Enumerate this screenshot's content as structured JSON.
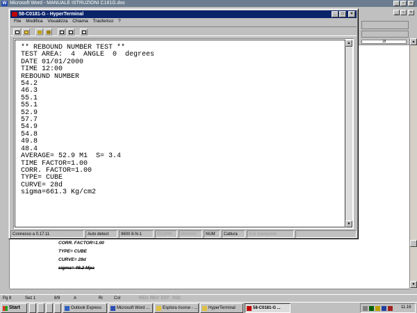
{
  "word": {
    "title": "Microsoft Word - MANUALE ISTRUZIONI C181G.doc",
    "app_icon": "W",
    "ruler_label": "18",
    "doc_lines": [
      "CORR. FACTOR=1.00",
      "TYPE= CUBE",
      "CURVE= 28d",
      "sigma= 49.2 Mpa"
    ],
    "status": {
      "page": "Pg 8",
      "section": "Sez 1",
      "pages": "8/9",
      "at": "A",
      "line": "Ri",
      "col": "Col",
      "rec": "REG",
      "rev": "REV",
      "ext": "EST",
      "ovr": "SSC"
    }
  },
  "hyperterminal": {
    "title": "58-C0181-G - HyperTerminal",
    "menu": [
      "File",
      "Modifica",
      "Visualizza",
      "Chiama",
      "Trasferisci",
      "?"
    ],
    "toolbar_icons": [
      "new-icon",
      "open-icon",
      "phone-icon",
      "disconnect-icon",
      "send-icon",
      "receive-icon",
      "properties-icon"
    ],
    "terminal_lines": [
      "** REBOUND NUMBER TEST **",
      "TEST AREA:  4  ANGLE  0  degrees",
      "DATE 01/01/2000",
      "TIME 12:00",
      "REBOUND NUMBER",
      "54.2",
      "46.3",
      "55.1",
      "55.1",
      "52.9",
      "57.7",
      "54.9",
      "54.8",
      "49.8",
      "48.4",
      "AVERAGE= 52.9 M1  S= 3.4",
      "TIME FACTOR=1.00",
      "CORR. FACTOR=1.00",
      "TYPE= CUBE",
      "CURVE= 28d",
      "sigma=661.3 Kg/cm2"
    ],
    "status": {
      "connection": "Connesso a 0.17.11",
      "detect": "Auto detect",
      "port": "9600 8-N-1",
      "scroll": "SCORR",
      "caps": "MAIUSC",
      "num": "NUM",
      "capture": "Cattura",
      "echo": "Eco stampante"
    }
  },
  "taskbar": {
    "start": "Start",
    "tasks": [
      "Outlook Express",
      "Microsoft Word ...",
      "Esplora risorse - ...",
      "HyperTerminal",
      "58-C0181-G ..."
    ],
    "clock": "11.16"
  }
}
